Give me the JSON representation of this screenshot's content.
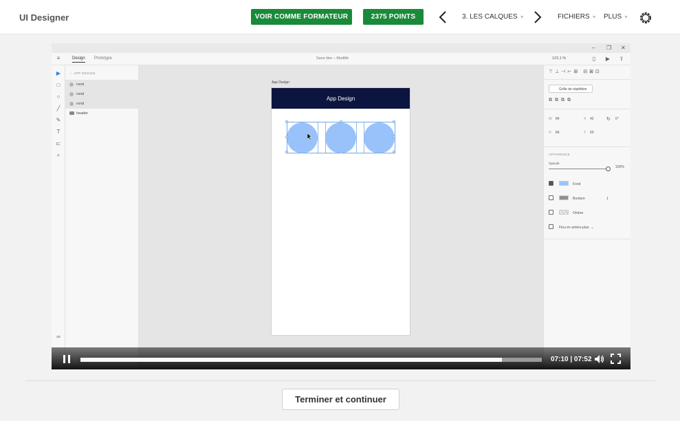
{
  "header": {
    "app_title": "UI Designer",
    "trainer_button": "VOIR COMME FORMATEUR",
    "points_button": "2375 POINTS",
    "lesson_title": "3. LES CALQUES",
    "files_menu": "FICHIERS",
    "more_menu": "PLUS"
  },
  "video": {
    "xd": {
      "window_controls": [
        "–",
        "❐",
        "✕"
      ],
      "tabs": [
        "Design",
        "Prototype"
      ],
      "document_title": "Sans titre – Modifié",
      "zoom": "123,1 %",
      "layers_header": "APP DESIGN",
      "layers": [
        "rond",
        "rond",
        "rond",
        "header"
      ],
      "artboard_label": "App Design",
      "artboard_header": "App Design",
      "properties": {
        "repeat_grid": "Grille de répétition",
        "w_label": "W",
        "w_value": "84",
        "x_label": "X",
        "x_value": "42",
        "rotation": "0°",
        "h_label": "H",
        "h_value": "84",
        "y_label": "Y",
        "y_value": "50",
        "appearance": "APPARENCE",
        "opacity_label": "Opacité",
        "opacity_value": "100%",
        "opacity": 1.0,
        "fill_label": "Fond",
        "fill_color": "#99c2fb",
        "border_label": "Bordure",
        "border_value": "1",
        "shadow_label": "Ombre",
        "blur_label": "Flou en arrière-plan"
      }
    },
    "player": {
      "time": "07:10 | 07:52",
      "progress": 0.913,
      "buffered": 1.0
    }
  },
  "footer": {
    "finish_button": "Terminer et continuer"
  },
  "colors": {
    "brand_green": "#1a8a3a",
    "artboard_header": "#0c1540",
    "circle_fill": "#99c2fb"
  }
}
